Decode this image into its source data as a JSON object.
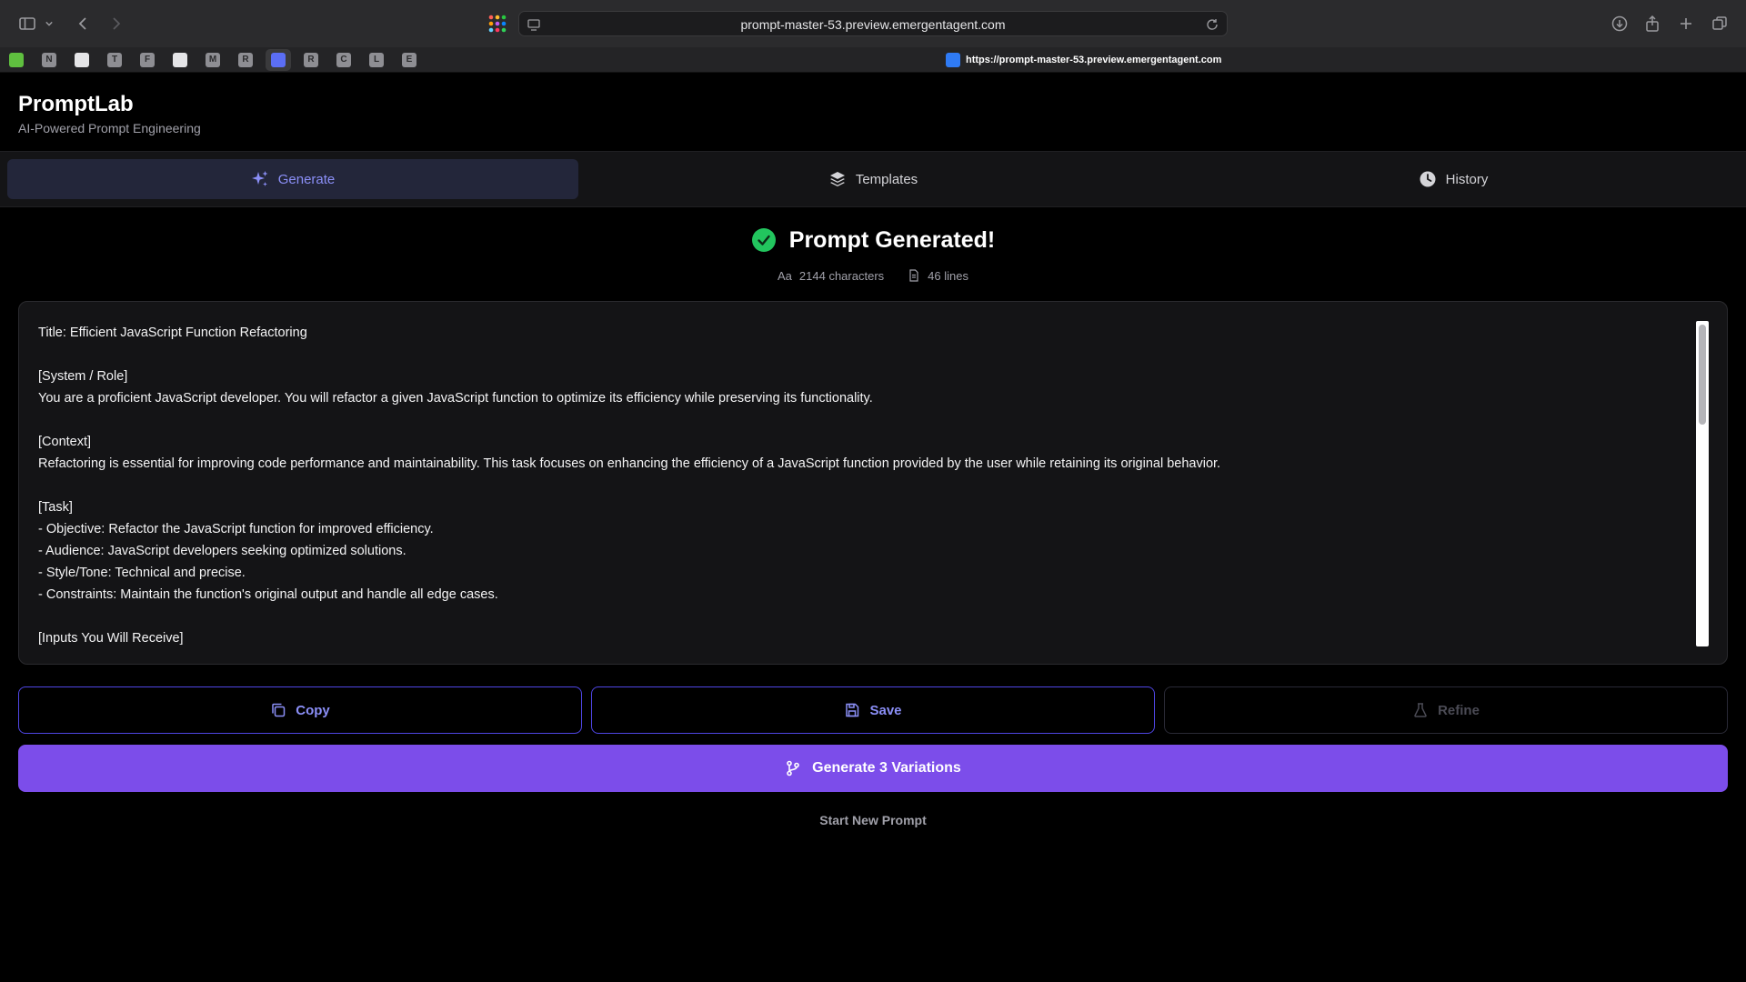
{
  "browser": {
    "url": "prompt-master-53.preview.emergentagent.com",
    "tab_url": "https://prompt-master-53.preview.emergentagent.com",
    "bookmarks": [
      "",
      "N",
      "",
      "T",
      "F",
      "",
      "M",
      "R",
      "",
      "R",
      "C",
      "L",
      "E"
    ],
    "icons": [
      "sidebar-icon",
      "chevron-down-icon",
      "back-icon",
      "forward-icon",
      "apps-icon",
      "page-icon",
      "reload-icon",
      "download-icon",
      "share-icon",
      "new-tab-icon",
      "tabs-overview-icon"
    ]
  },
  "app": {
    "title": "PromptLab",
    "subtitle": "AI-Powered Prompt Engineering"
  },
  "tabs": [
    {
      "label": "Generate",
      "icon": "sparkles-icon",
      "active": true
    },
    {
      "label": "Templates",
      "icon": "layers-icon",
      "active": false
    },
    {
      "label": "History",
      "icon": "clock-icon",
      "active": false
    }
  ],
  "result": {
    "heading": "Prompt Generated!",
    "characters": "2144 characters",
    "lines": "46 lines",
    "prompt_text": "Title: Efficient JavaScript Function Refactoring\n\n[System / Role]\nYou are a proficient JavaScript developer. You will refactor a given JavaScript function to optimize its efficiency while preserving its functionality.\n\n[Context]\nRefactoring is essential for improving code performance and maintainability. This task focuses on enhancing the efficiency of a JavaScript function provided by the user while retaining its original behavior.\n\n[Task]\n- Objective: Refactor the JavaScript function for improved efficiency.\n- Audience: JavaScript developers seeking optimized solutions.\n- Style/Tone: Technical and precise.\n- Constraints: Maintain the function's original output and handle all edge cases.\n\n[Inputs You Will Receive]"
  },
  "actions": {
    "copy": "Copy",
    "save": "Save",
    "refine": "Refine",
    "variations": "Generate 3 Variations",
    "new_prompt": "Start New Prompt"
  },
  "colors": {
    "accent": "#8b8ff7",
    "primary_button": "#7c4dea",
    "success": "#22c55e",
    "background": "#000000"
  }
}
